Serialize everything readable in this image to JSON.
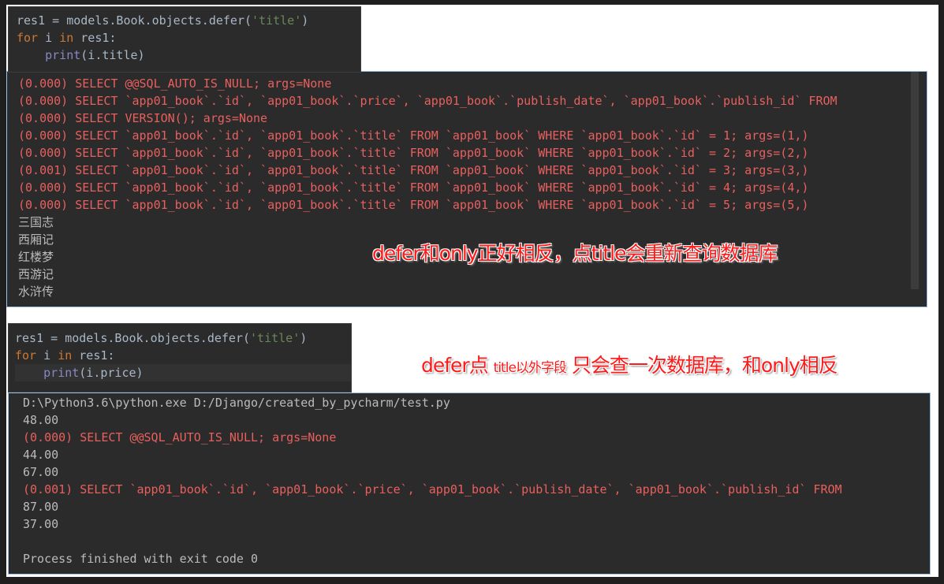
{
  "top_code": {
    "line1": {
      "pre": "res1 = models.Book.objects.defer(",
      "str": "'title'",
      "post": ")"
    },
    "line2": {
      "kw1": "for",
      "mid": " i ",
      "kw2": "in",
      "post": " res1:"
    },
    "line3": {
      "indent": "    ",
      "fn": "print",
      "post": "(i.title)"
    }
  },
  "top_console": {
    "sql_lines": [
      "(0.000) SELECT @@SQL_AUTO_IS_NULL; args=None",
      "(0.000) SELECT `app01_book`.`id`, `app01_book`.`price`, `app01_book`.`publish_date`, `app01_book`.`publish_id` FROM",
      "(0.000) SELECT VERSION(); args=None",
      "(0.000) SELECT `app01_book`.`id`, `app01_book`.`title` FROM `app01_book` WHERE `app01_book`.`id` = 1; args=(1,)",
      "(0.000) SELECT `app01_book`.`id`, `app01_book`.`title` FROM `app01_book` WHERE `app01_book`.`id` = 2; args=(2,)",
      "(0.001) SELECT `app01_book`.`id`, `app01_book`.`title` FROM `app01_book` WHERE `app01_book`.`id` = 3; args=(3,)",
      "(0.000) SELECT `app01_book`.`id`, `app01_book`.`title` FROM `app01_book` WHERE `app01_book`.`id` = 4; args=(4,)",
      "(0.000) SELECT `app01_book`.`id`, `app01_book`.`title` FROM `app01_book` WHERE `app01_book`.`id` = 5; args=(5,)"
    ],
    "titles": [
      "三国志",
      "西厢记",
      "红楼梦",
      "西游记",
      "水浒传"
    ]
  },
  "note1": "defer和only正好相反，点title会重新查询数据库",
  "bottom_code": {
    "line1": {
      "pre": "res1 = models.Book.objects.defer(",
      "str": "'title'",
      "post": ")"
    },
    "line2": {
      "kw1": "for",
      "mid": " i ",
      "kw2": "in",
      "post": " res1:"
    },
    "line3": {
      "indent": "    ",
      "fn": "print",
      "post": "(i.price)"
    }
  },
  "note2": {
    "a": "defer点 ",
    "b": "title以外字段",
    "c": " 只会查一次数据库，和only相反"
  },
  "bottom_console": {
    "lines": [
      {
        "text": "D:\\Python3.6\\python.exe D:/Django/created_by_pycharm/test.py",
        "type": "gray"
      },
      {
        "text": "48.00",
        "type": "gray"
      },
      {
        "text": "(0.000) SELECT @@SQL_AUTO_IS_NULL; args=None",
        "type": "red"
      },
      {
        "text": "44.00",
        "type": "gray"
      },
      {
        "text": "67.00",
        "type": "gray"
      },
      {
        "text": "(0.001) SELECT `app01_book`.`id`, `app01_book`.`price`, `app01_book`.`publish_date`, `app01_book`.`publish_id` FROM",
        "type": "red"
      },
      {
        "text": "87.00",
        "type": "gray"
      },
      {
        "text": "37.00",
        "type": "gray"
      },
      {
        "text": "",
        "type": "gray"
      },
      {
        "text": "Process finished with exit code 0",
        "type": "gray"
      }
    ]
  },
  "colors": {
    "console_bg": "#2b2b2b",
    "sql": "#e8605e",
    "output": "#bbbbbb",
    "keyword": "#cc7832",
    "string": "#6a8759",
    "annotation": "#ff1a1a"
  }
}
